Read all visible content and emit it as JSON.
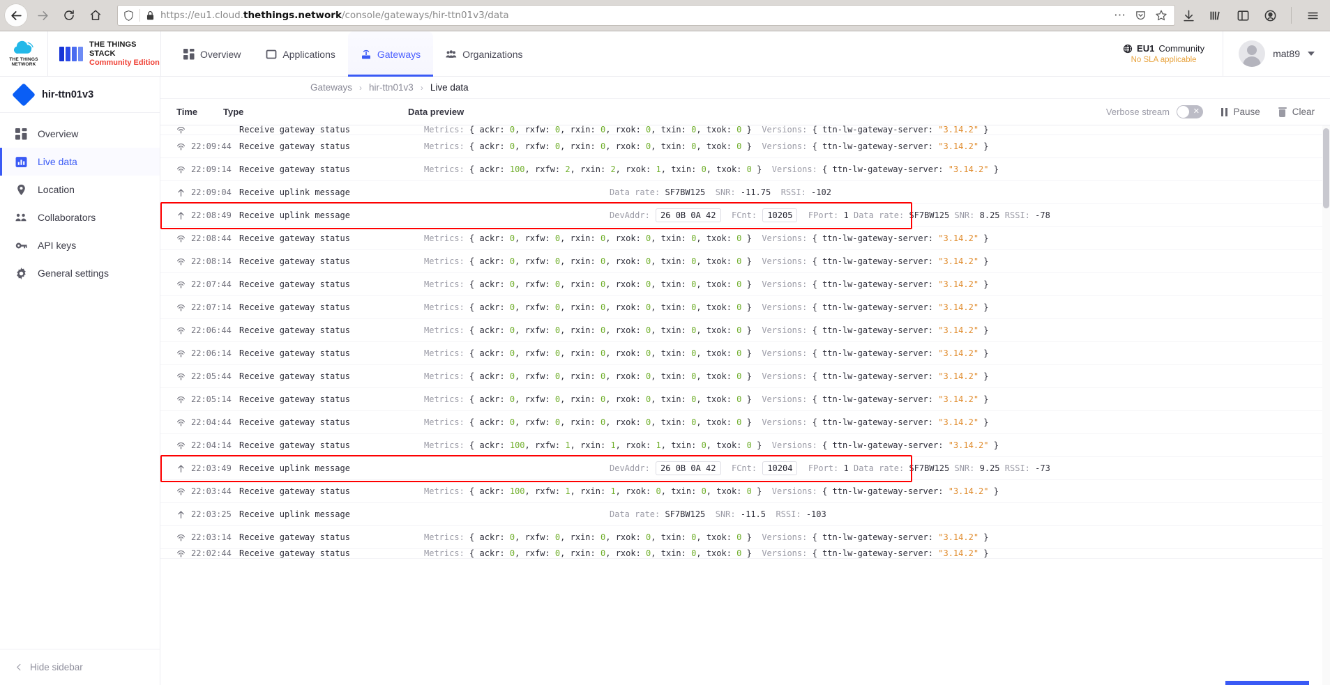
{
  "browser": {
    "url_prefix": "https://",
    "url_sub": "eu1.cloud.",
    "url_domain": "thethings.network",
    "url_path": "/console/gateways/hir-ttn01v3/data",
    "back_icon": "back-arrow-icon",
    "forward_icon": "forward-arrow-icon",
    "reload_icon": "reload-icon",
    "home_icon": "home-icon",
    "shield_icon": "shield-icon",
    "lock_icon": "lock-icon",
    "more_icon": "ellipsis-icon",
    "pocket_icon": "pocket-icon",
    "bookmark_icon": "star-icon",
    "downloads_icon": "download-icon",
    "library_icon": "library-icon",
    "sidebar_icon": "sidebar-icon",
    "account_icon": "account-icon",
    "menu_icon": "hamburger-menu-icon"
  },
  "header": {
    "logo_caption_line1": "THE THINGS",
    "logo_caption_line2": "NETWORK",
    "stack_title": "THE THINGS STACK",
    "stack_subtitle": "Community Edition",
    "nav": [
      {
        "label": "Overview",
        "icon": "grid-icon",
        "active": false
      },
      {
        "label": "Applications",
        "icon": "square-icon",
        "active": false
      },
      {
        "label": "Gateways",
        "icon": "gateway-icon",
        "active": true
      },
      {
        "label": "Organizations",
        "icon": "people-icon",
        "active": false
      }
    ],
    "cluster_region": "EU1",
    "cluster_name": "Community",
    "cluster_icon": "globe-icon",
    "sla_text": "No SLA applicable",
    "user_name": "mat89",
    "user_caret": "chevron-down-icon"
  },
  "sidebar": {
    "gateway_name": "hir-ttn01v3",
    "gateway_icon": "gateway-diamond-icon",
    "items": [
      {
        "label": "Overview",
        "icon": "grid-icon",
        "active": false
      },
      {
        "label": "Live data",
        "icon": "chart-icon",
        "active": true
      },
      {
        "label": "Location",
        "icon": "pin-icon",
        "active": false
      },
      {
        "label": "Collaborators",
        "icon": "people-icon",
        "active": false
      },
      {
        "label": "API keys",
        "icon": "key-icon",
        "active": false
      },
      {
        "label": "General settings",
        "icon": "gear-icon",
        "active": false
      }
    ],
    "hide_label": "Hide sidebar",
    "hide_icon": "chevron-left-icon"
  },
  "breadcrumb": {
    "items": [
      "Gateways",
      "hir-ttn01v3",
      "Live data"
    ],
    "separator": "›"
  },
  "table": {
    "columns": {
      "time": "Time",
      "type": "Type",
      "data": "Data preview"
    },
    "controls": {
      "verbose_label": "Verbose stream",
      "verbose_on": false,
      "toggle_glyph": "✕",
      "pause_label": "Pause",
      "pause_icon": "pause-icon",
      "clear_label": "Clear",
      "clear_icon": "trash-icon"
    }
  },
  "events": [
    {
      "partial": true,
      "time": "",
      "type": "Receive gateway status",
      "kind": "status",
      "metrics": {
        "ackr": "0",
        "rxfw": "0",
        "rxin": "0",
        "rxok": "0",
        "txin": "0",
        "txok": "0"
      },
      "version": "3.14.2",
      "highlight": false
    },
    {
      "time": "22:09:44",
      "type": "Receive gateway status",
      "kind": "status",
      "metrics": {
        "ackr": "0",
        "rxfw": "0",
        "rxin": "0",
        "rxok": "0",
        "txin": "0",
        "txok": "0"
      },
      "version": "3.14.2",
      "highlight": false
    },
    {
      "time": "22:09:14",
      "type": "Receive gateway status",
      "kind": "status",
      "metrics": {
        "ackr": "100",
        "rxfw": "2",
        "rxin": "2",
        "rxok": "1",
        "txin": "0",
        "txok": "0"
      },
      "version": "3.14.2",
      "highlight": false
    },
    {
      "time": "22:09:04",
      "type": "Receive uplink message",
      "kind": "uplink-simple",
      "data_rate": "SF7BW125",
      "snr": "-11.75",
      "rssi": "-102",
      "highlight": false
    },
    {
      "time": "22:08:49",
      "type": "Receive uplink message",
      "kind": "uplink-full",
      "dev_addr": "26 0B 0A 42",
      "fcnt": "10205",
      "fport": "1",
      "data_rate": "SF7BW125",
      "snr": "8.25",
      "rssi": "-78",
      "highlight": true
    },
    {
      "time": "22:08:44",
      "type": "Receive gateway status",
      "kind": "status",
      "metrics": {
        "ackr": "0",
        "rxfw": "0",
        "rxin": "0",
        "rxok": "0",
        "txin": "0",
        "txok": "0"
      },
      "version": "3.14.2",
      "highlight": false
    },
    {
      "time": "22:08:14",
      "type": "Receive gateway status",
      "kind": "status",
      "metrics": {
        "ackr": "0",
        "rxfw": "0",
        "rxin": "0",
        "rxok": "0",
        "txin": "0",
        "txok": "0"
      },
      "version": "3.14.2",
      "highlight": false
    },
    {
      "time": "22:07:44",
      "type": "Receive gateway status",
      "kind": "status",
      "metrics": {
        "ackr": "0",
        "rxfw": "0",
        "rxin": "0",
        "rxok": "0",
        "txin": "0",
        "txok": "0"
      },
      "version": "3.14.2",
      "highlight": false
    },
    {
      "time": "22:07:14",
      "type": "Receive gateway status",
      "kind": "status",
      "metrics": {
        "ackr": "0",
        "rxfw": "0",
        "rxin": "0",
        "rxok": "0",
        "txin": "0",
        "txok": "0"
      },
      "version": "3.14.2",
      "highlight": false
    },
    {
      "time": "22:06:44",
      "type": "Receive gateway status",
      "kind": "status",
      "metrics": {
        "ackr": "0",
        "rxfw": "0",
        "rxin": "0",
        "rxok": "0",
        "txin": "0",
        "txok": "0"
      },
      "version": "3.14.2",
      "highlight": false
    },
    {
      "time": "22:06:14",
      "type": "Receive gateway status",
      "kind": "status",
      "metrics": {
        "ackr": "0",
        "rxfw": "0",
        "rxin": "0",
        "rxok": "0",
        "txin": "0",
        "txok": "0"
      },
      "version": "3.14.2",
      "highlight": false
    },
    {
      "time": "22:05:44",
      "type": "Receive gateway status",
      "kind": "status",
      "metrics": {
        "ackr": "0",
        "rxfw": "0",
        "rxin": "0",
        "rxok": "0",
        "txin": "0",
        "txok": "0"
      },
      "version": "3.14.2",
      "highlight": false
    },
    {
      "time": "22:05:14",
      "type": "Receive gateway status",
      "kind": "status",
      "metrics": {
        "ackr": "0",
        "rxfw": "0",
        "rxin": "0",
        "rxok": "0",
        "txin": "0",
        "txok": "0"
      },
      "version": "3.14.2",
      "highlight": false
    },
    {
      "time": "22:04:44",
      "type": "Receive gateway status",
      "kind": "status",
      "metrics": {
        "ackr": "0",
        "rxfw": "0",
        "rxin": "0",
        "rxok": "0",
        "txin": "0",
        "txok": "0"
      },
      "version": "3.14.2",
      "highlight": false
    },
    {
      "time": "22:04:14",
      "type": "Receive gateway status",
      "kind": "status",
      "metrics": {
        "ackr": "100",
        "rxfw": "1",
        "rxin": "1",
        "rxok": "1",
        "txin": "0",
        "txok": "0"
      },
      "version": "3.14.2",
      "highlight": false
    },
    {
      "time": "22:03:49",
      "type": "Receive uplink message",
      "kind": "uplink-full",
      "dev_addr": "26 0B 0A 42",
      "fcnt": "10204",
      "fport": "1",
      "data_rate": "SF7BW125",
      "snr": "9.25",
      "rssi": "-73",
      "highlight": true
    },
    {
      "time": "22:03:44",
      "type": "Receive gateway status",
      "kind": "status",
      "metrics": {
        "ackr": "100",
        "rxfw": "1",
        "rxin": "1",
        "rxok": "0",
        "txin": "0",
        "txok": "0"
      },
      "version": "3.14.2",
      "highlight": false
    },
    {
      "time": "22:03:25",
      "type": "Receive uplink message",
      "kind": "uplink-simple",
      "data_rate": "SF7BW125",
      "snr": "-11.5",
      "rssi": "-103",
      "highlight": false
    },
    {
      "time": "22:03:14",
      "type": "Receive gateway status",
      "kind": "status",
      "metrics": {
        "ackr": "0",
        "rxfw": "0",
        "rxin": "0",
        "rxok": "0",
        "txin": "0",
        "txok": "0"
      },
      "version": "3.14.2",
      "highlight": false
    },
    {
      "partial": true,
      "time": "22:02:44",
      "type": "Receive gateway status",
      "kind": "status",
      "metrics": {
        "ackr": "0",
        "rxfw": "0",
        "rxin": "0",
        "rxok": "0",
        "txin": "0",
        "txok": "0"
      },
      "version": "3.14.2",
      "highlight": false
    }
  ],
  "labels": {
    "metrics": "Metrics:",
    "versions": "Versions:",
    "gateway_server_key": "ttn-lw-gateway-server:",
    "dev_addr": "DevAddr:",
    "fcnt": "FCnt:",
    "fport": "FPort:",
    "data_rate": "Data rate:",
    "snr": "SNR:",
    "rssi": "RSSI:"
  },
  "colors": {
    "accent": "#3a5af5",
    "red_highlight": "#ff0000",
    "string_orange": "#e08b2c",
    "number_green": "#6fae2a",
    "brand_red": "#ef4136",
    "sla_orange": "#e8a33d"
  }
}
